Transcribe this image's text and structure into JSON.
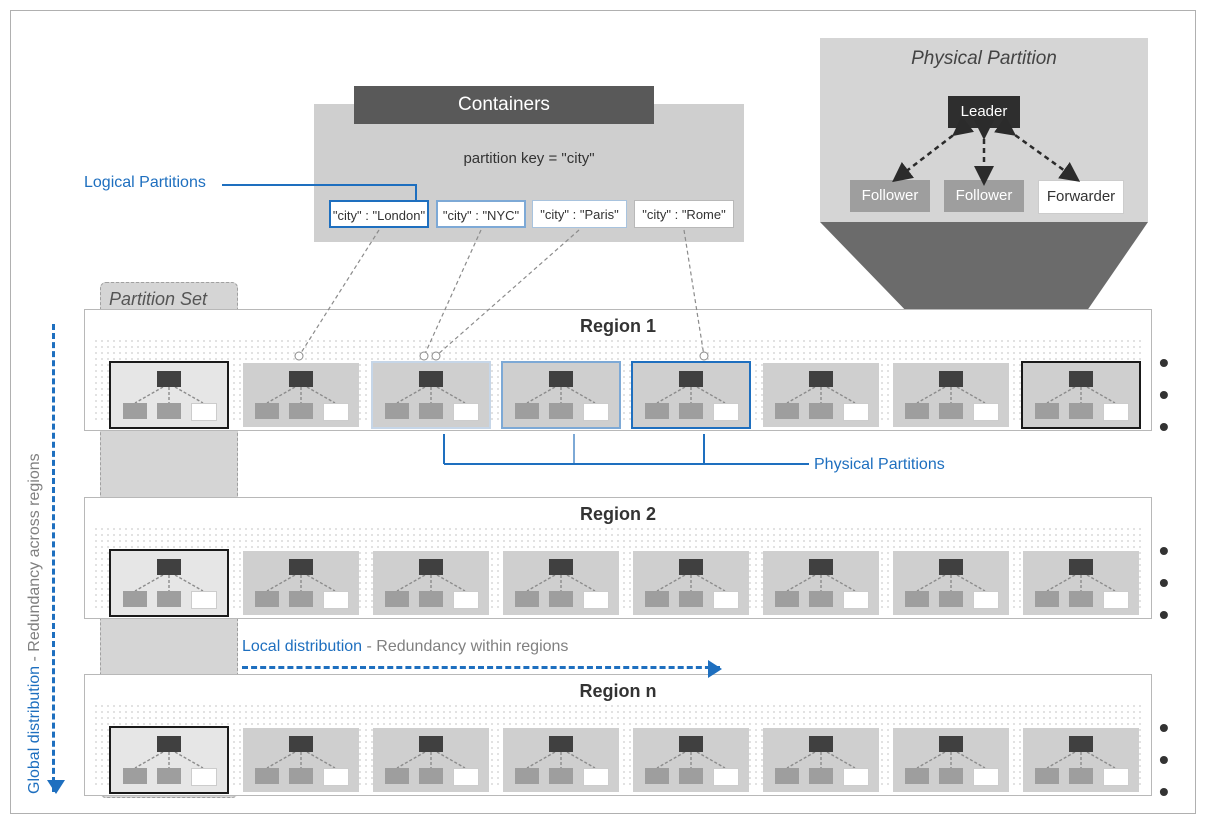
{
  "containers": {
    "title": "Containers",
    "partition_key_label": "partition key = \"city\"",
    "logical_partitions_label": "Logical Partitions",
    "kv_boxes": [
      "\"city\" : \"London\"",
      "\"city\" : \"NYC\"",
      "\"city\" : \"Paris\"",
      "\"city\" : \"Rome\""
    ]
  },
  "detail": {
    "title": "Physical Partition",
    "leader": "Leader",
    "follower": "Follower",
    "forwarder": "Forwarder"
  },
  "partition_set_label": "Partition Set",
  "regions": {
    "r1": "Region 1",
    "r2": "Region 2",
    "r3": "Region n"
  },
  "physical_partitions_label": "Physical Partitions",
  "global_distribution": {
    "title": "Global distribution",
    "subtitle": "  -  Redundancy across regions"
  },
  "local_distribution": {
    "title": "Local distribution",
    "subtitle": "  -  Redundancy within regions"
  },
  "ellipsis": "• • •",
  "colors": {
    "accent": "#1E6FBF",
    "light_grey": "#CFCFCF",
    "mid_grey": "#9E9E9E",
    "charcoal": "#595959"
  }
}
